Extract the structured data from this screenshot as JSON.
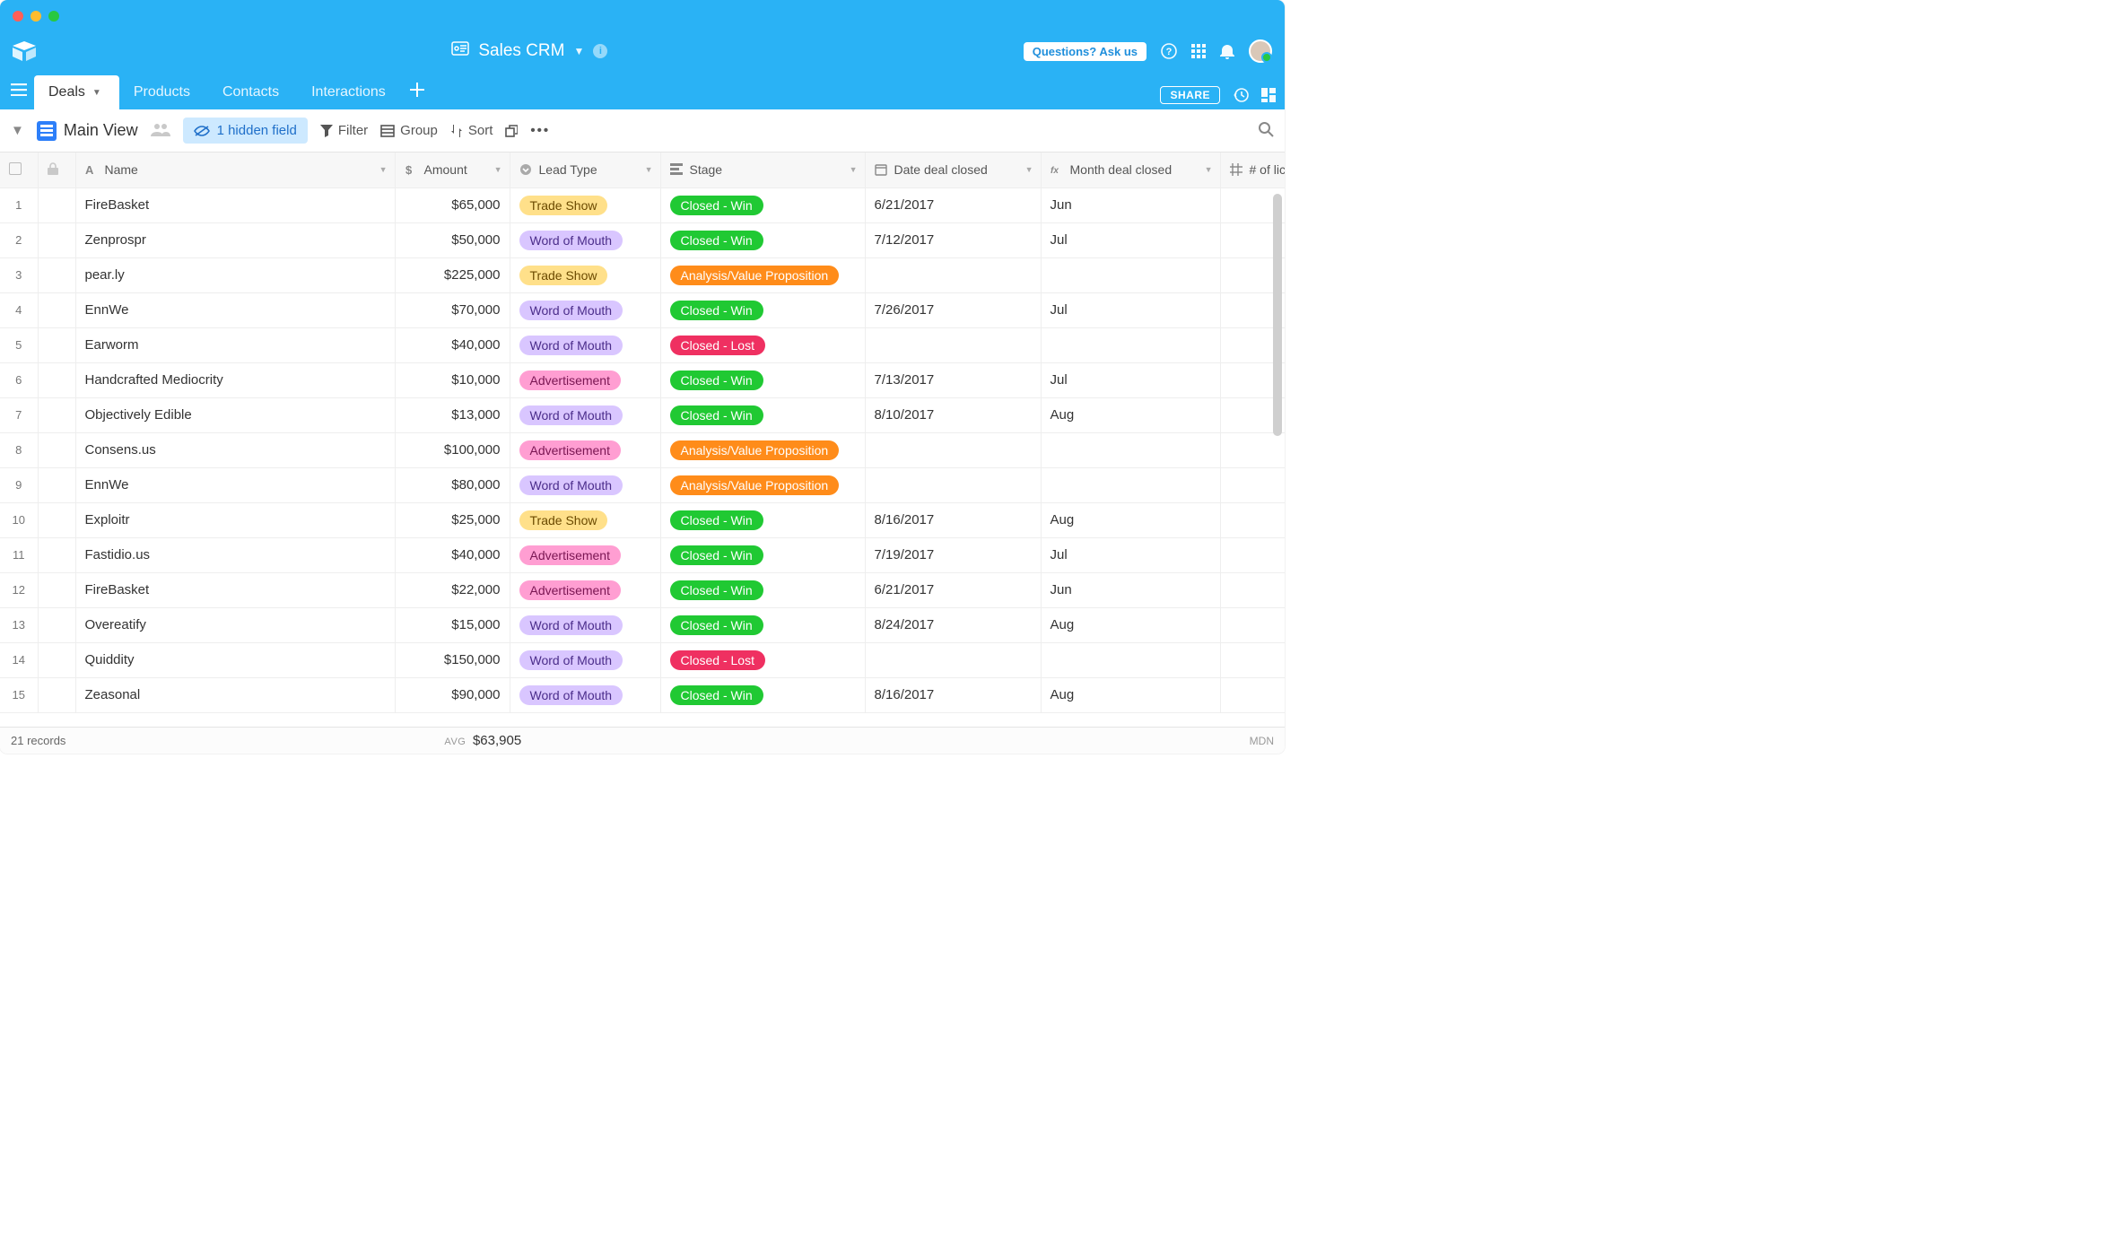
{
  "app": {
    "title": "Sales CRM",
    "ask_label": "Questions? Ask us"
  },
  "tabs": [
    {
      "label": "Deals",
      "active": true
    },
    {
      "label": "Products",
      "active": false
    },
    {
      "label": "Contacts",
      "active": false
    },
    {
      "label": "Interactions",
      "active": false
    }
  ],
  "share_label": "SHARE",
  "toolbar": {
    "view_name": "Main View",
    "hidden_field_label": "1 hidden field",
    "filter_label": "Filter",
    "group_label": "Group",
    "sort_label": "Sort"
  },
  "columns": [
    {
      "key": "name",
      "label": "Name",
      "icon": "text"
    },
    {
      "key": "amount",
      "label": "Amount",
      "icon": "currency"
    },
    {
      "key": "lead_type",
      "label": "Lead Type",
      "icon": "select"
    },
    {
      "key": "stage",
      "label": "Stage",
      "icon": "multiselect"
    },
    {
      "key": "date_closed",
      "label": "Date deal closed",
      "icon": "calendar"
    },
    {
      "key": "month_closed",
      "label": "Month deal closed",
      "icon": "formula"
    },
    {
      "key": "licenses",
      "label": "# of licens",
      "icon": "number"
    }
  ],
  "lead_type_colors": {
    "Trade Show": {
      "bg": "#ffe08a",
      "fg": "#6b4a00"
    },
    "Word of Mouth": {
      "bg": "#d9c6ff",
      "fg": "#4b2d8a"
    },
    "Advertisement": {
      "bg": "#ff9ed2",
      "fg": "#7a1653"
    }
  },
  "stage_colors": {
    "Closed - Win": {
      "bg": "#20c933",
      "fg": "#ffffff"
    },
    "Analysis/Value Proposition": {
      "bg": "#ff8c1a",
      "fg": "#ffffff"
    },
    "Closed - Lost": {
      "bg": "#ef3061",
      "fg": "#ffffff"
    }
  },
  "rows": [
    {
      "name": "FireBasket",
      "amount": "$65,000",
      "lead_type": "Trade Show",
      "stage": "Closed - Win",
      "date_closed": "6/21/2017",
      "month_closed": "Jun"
    },
    {
      "name": "Zenprospr",
      "amount": "$50,000",
      "lead_type": "Word of Mouth",
      "stage": "Closed - Win",
      "date_closed": "7/12/2017",
      "month_closed": "Jul"
    },
    {
      "name": "pear.ly",
      "amount": "$225,000",
      "lead_type": "Trade Show",
      "stage": "Analysis/Value Proposition",
      "date_closed": "",
      "month_closed": ""
    },
    {
      "name": "EnnWe",
      "amount": "$70,000",
      "lead_type": "Word of Mouth",
      "stage": "Closed - Win",
      "date_closed": "7/26/2017",
      "month_closed": "Jul"
    },
    {
      "name": "Earworm",
      "amount": "$40,000",
      "lead_type": "Word of Mouth",
      "stage": "Closed - Lost",
      "date_closed": "",
      "month_closed": ""
    },
    {
      "name": "Handcrafted Mediocrity",
      "amount": "$10,000",
      "lead_type": "Advertisement",
      "stage": "Closed - Win",
      "date_closed": "7/13/2017",
      "month_closed": "Jul"
    },
    {
      "name": "Objectively Edible",
      "amount": "$13,000",
      "lead_type": "Word of Mouth",
      "stage": "Closed - Win",
      "date_closed": "8/10/2017",
      "month_closed": "Aug"
    },
    {
      "name": "Consens.us",
      "amount": "$100,000",
      "lead_type": "Advertisement",
      "stage": "Analysis/Value Proposition",
      "date_closed": "",
      "month_closed": ""
    },
    {
      "name": "EnnWe",
      "amount": "$80,000",
      "lead_type": "Word of Mouth",
      "stage": "Analysis/Value Proposition",
      "date_closed": "",
      "month_closed": ""
    },
    {
      "name": "Exploitr",
      "amount": "$25,000",
      "lead_type": "Trade Show",
      "stage": "Closed - Win",
      "date_closed": "8/16/2017",
      "month_closed": "Aug"
    },
    {
      "name": "Fastidio.us",
      "amount": "$40,000",
      "lead_type": "Advertisement",
      "stage": "Closed - Win",
      "date_closed": "7/19/2017",
      "month_closed": "Jul"
    },
    {
      "name": "FireBasket",
      "amount": "$22,000",
      "lead_type": "Advertisement",
      "stage": "Closed - Win",
      "date_closed": "6/21/2017",
      "month_closed": "Jun"
    },
    {
      "name": "Overeatify",
      "amount": "$15,000",
      "lead_type": "Word of Mouth",
      "stage": "Closed - Win",
      "date_closed": "8/24/2017",
      "month_closed": "Aug"
    },
    {
      "name": "Quiddity",
      "amount": "$150,000",
      "lead_type": "Word of Mouth",
      "stage": "Closed - Lost",
      "date_closed": "",
      "month_closed": ""
    },
    {
      "name": "Zeasonal",
      "amount": "$90,000",
      "lead_type": "Word of Mouth",
      "stage": "Closed - Win",
      "date_closed": "8/16/2017",
      "month_closed": "Aug"
    }
  ],
  "footer": {
    "record_count_label": "21 records",
    "avg_label": "AVG",
    "avg_value": "$63,905",
    "brand_corner": "MDN"
  }
}
